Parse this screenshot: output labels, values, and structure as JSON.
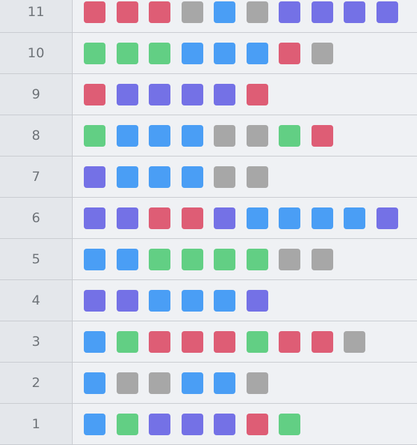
{
  "colors": {
    "red": "#de5d75",
    "green": "#62cf84",
    "blue": "#4a9ef5",
    "purple": "#7471e6",
    "gray": "#a7a7a7"
  },
  "rows": [
    {
      "label": "11",
      "cells": [
        "red",
        "red",
        "red",
        "gray",
        "blue",
        "gray",
        "purple",
        "purple",
        "purple",
        "purple"
      ]
    },
    {
      "label": "10",
      "cells": [
        "green",
        "green",
        "green",
        "blue",
        "blue",
        "blue",
        "red",
        "gray"
      ]
    },
    {
      "label": "9",
      "cells": [
        "red",
        "purple",
        "purple",
        "purple",
        "purple",
        "red"
      ]
    },
    {
      "label": "8",
      "cells": [
        "green",
        "blue",
        "blue",
        "blue",
        "gray",
        "gray",
        "green",
        "red"
      ]
    },
    {
      "label": "7",
      "cells": [
        "purple",
        "blue",
        "blue",
        "blue",
        "gray",
        "gray"
      ]
    },
    {
      "label": "6",
      "cells": [
        "purple",
        "purple",
        "red",
        "red",
        "purple",
        "blue",
        "blue",
        "blue",
        "blue",
        "purple"
      ]
    },
    {
      "label": "5",
      "cells": [
        "blue",
        "blue",
        "green",
        "green",
        "green",
        "green",
        "gray",
        "gray"
      ]
    },
    {
      "label": "4",
      "cells": [
        "purple",
        "purple",
        "blue",
        "blue",
        "blue",
        "purple"
      ]
    },
    {
      "label": "3",
      "cells": [
        "blue",
        "green",
        "red",
        "red",
        "red",
        "green",
        "red",
        "red",
        "gray"
      ]
    },
    {
      "label": "2",
      "cells": [
        "blue",
        "gray",
        "gray",
        "blue",
        "blue",
        "gray"
      ]
    },
    {
      "label": "1",
      "cells": [
        "blue",
        "green",
        "purple",
        "purple",
        "purple",
        "red",
        "green"
      ]
    }
  ]
}
